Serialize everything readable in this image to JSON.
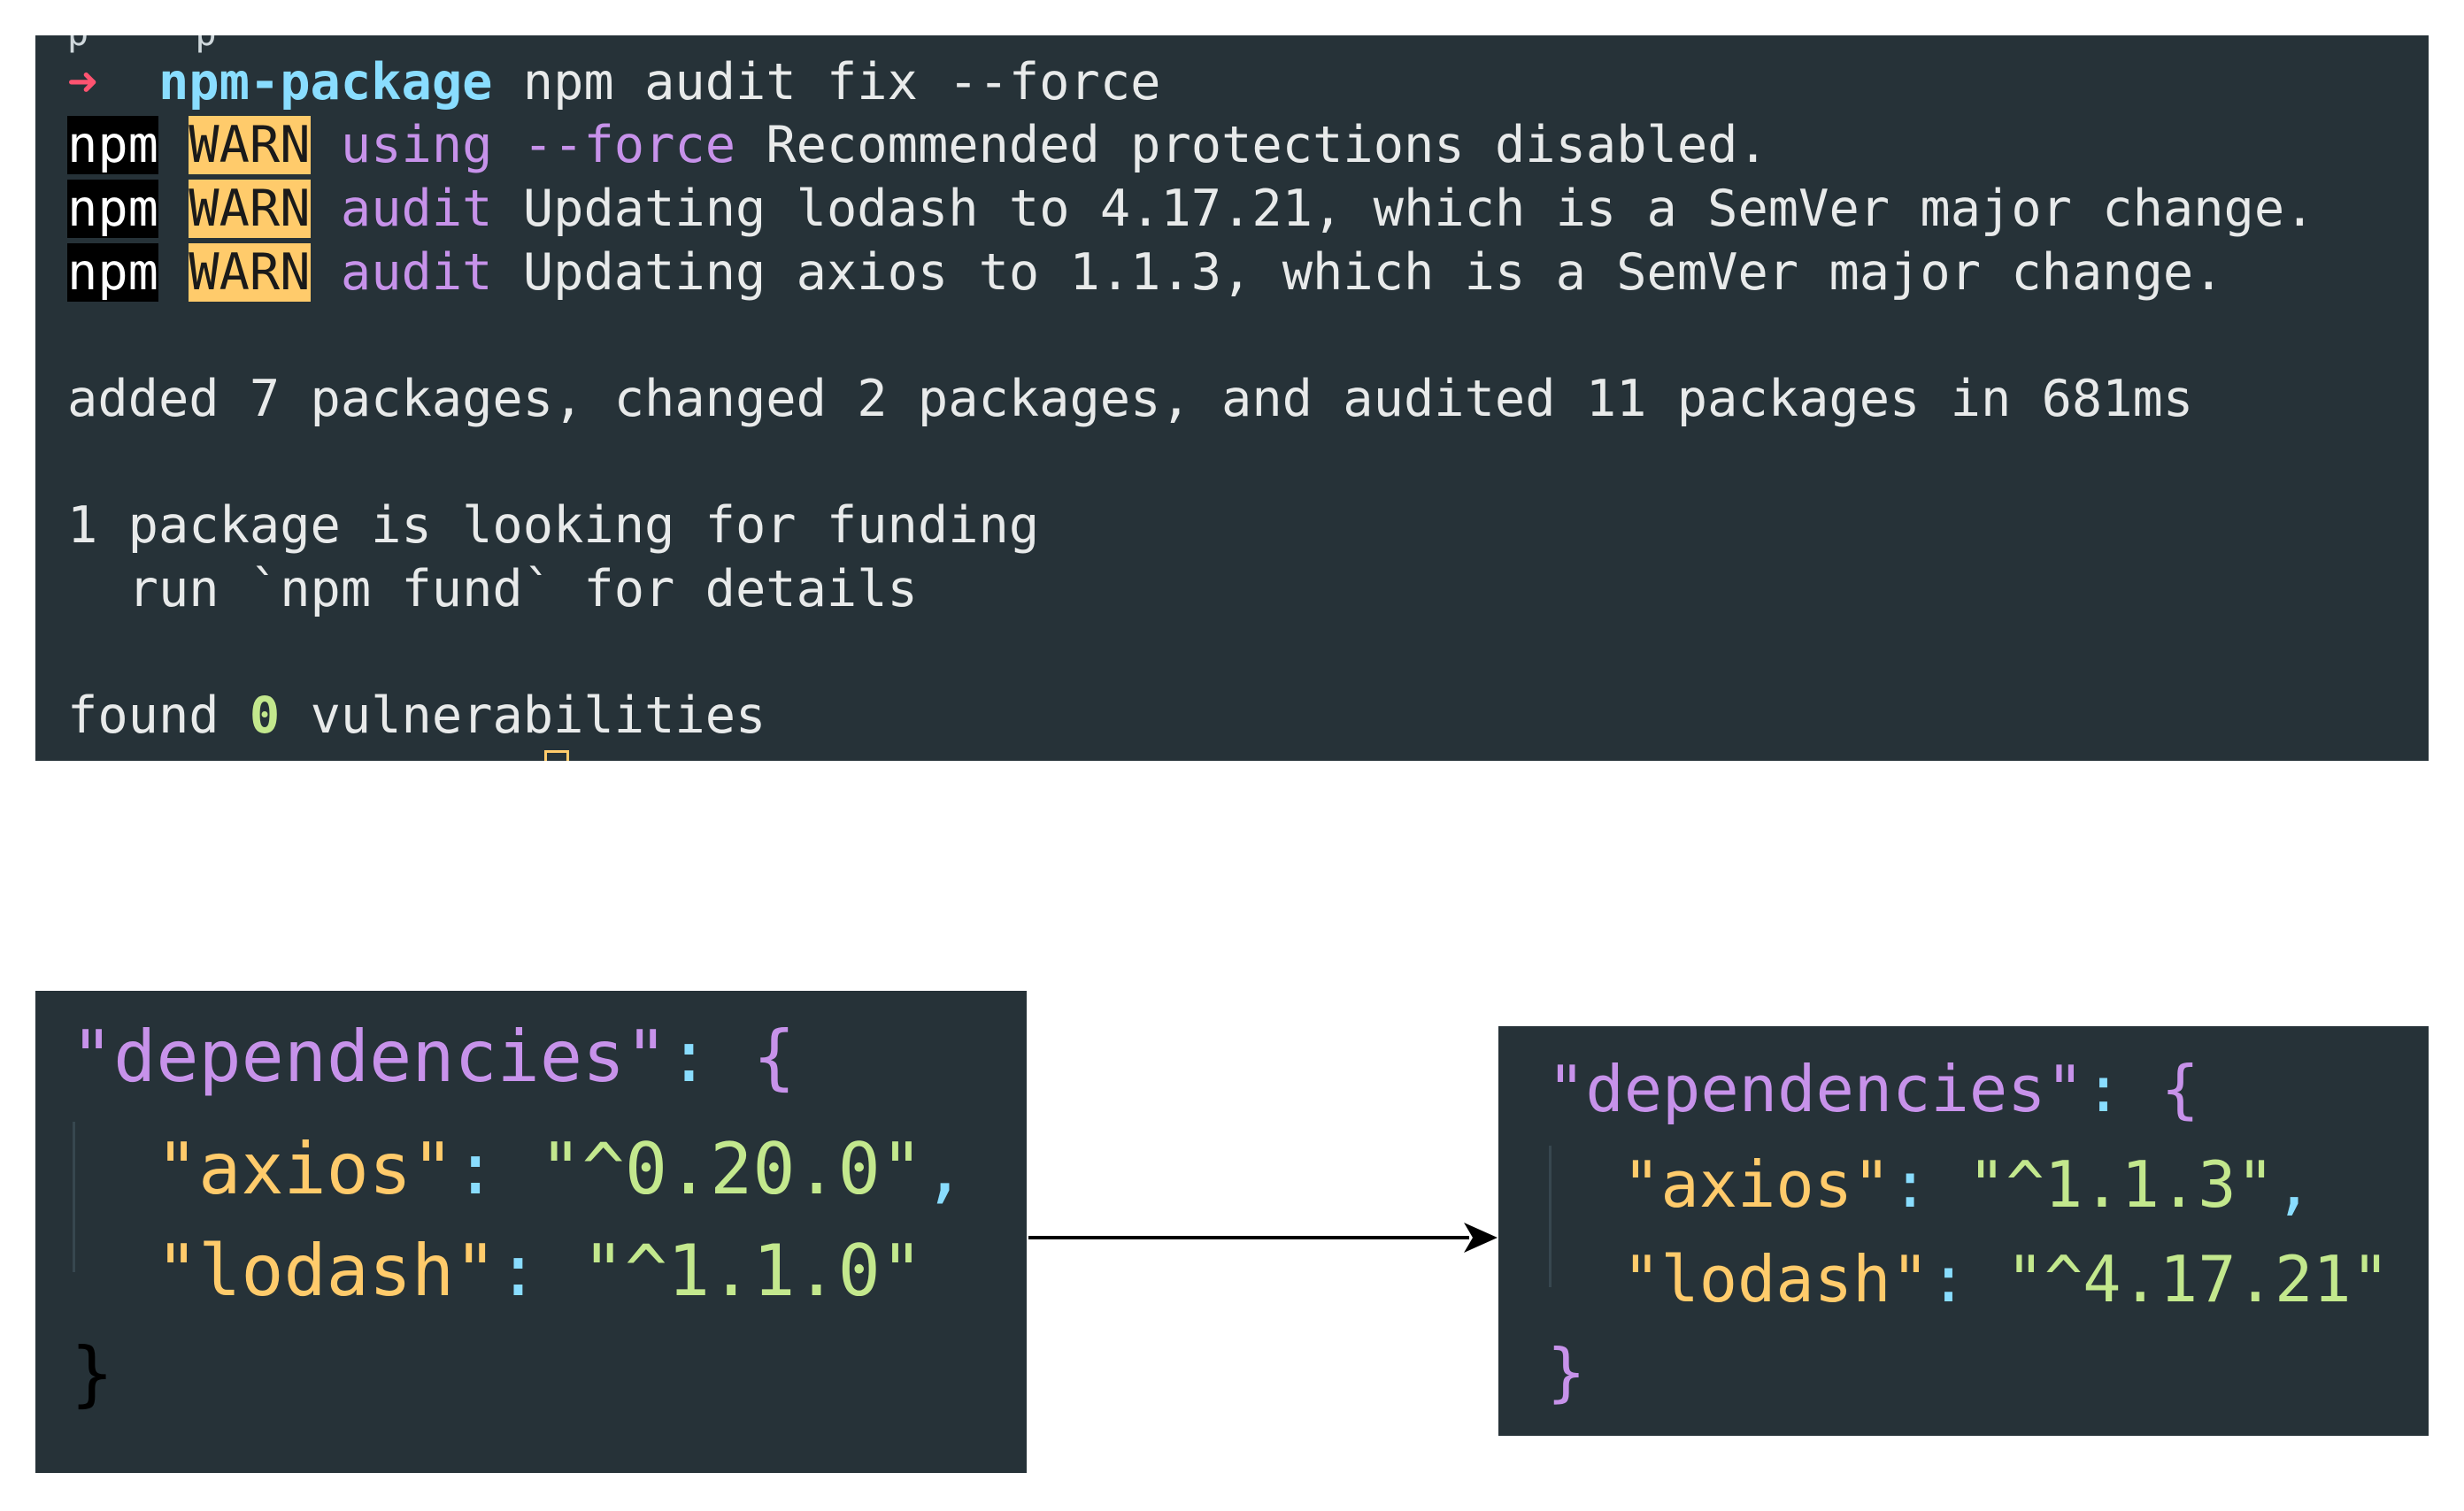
{
  "terminal": {
    "top_fragment": "p  ·  p",
    "prompt_arrow": "➜",
    "directory": "npm-package",
    "command": "npm audit fix --force",
    "warn_lines": [
      {
        "npm": "npm",
        "warn": "WARN",
        "keyword": "using",
        "keyword2": "--force",
        "message": "Recommended protections disabled."
      },
      {
        "npm": "npm",
        "warn": "WARN",
        "keyword": "audit",
        "message": "Updating lodash to 4.17.21, which is a SemVer major change."
      },
      {
        "npm": "npm",
        "warn": "WARN",
        "keyword": "audit",
        "message": "Updating axios to 1.1.3, which is a SemVer major change."
      }
    ],
    "summary": "added 7 packages, changed 2 packages, and audited 11 packages in 681ms",
    "funding_line1": "1 package is looking for funding",
    "funding_line2": "  run `npm fund` for details",
    "found_prefix": "found",
    "found_count": "0",
    "found_suffix": "vulnerabilities"
  },
  "before": {
    "key": "dependencies",
    "open_brace": "{",
    "close_brace": "}",
    "entries": [
      {
        "name": "axios",
        "version": "^0.20.0",
        "comma": ","
      },
      {
        "name": "lodash",
        "version": "^1.1.0",
        "comma": ""
      }
    ]
  },
  "after": {
    "key": "dependencies",
    "open_brace": "{",
    "close_brace": "}",
    "entries": [
      {
        "name": "axios",
        "version": "^1.1.3",
        "comma": ","
      },
      {
        "name": "lodash",
        "version": "^4.17.21",
        "comma": ""
      }
    ]
  },
  "colors": {
    "panel_bg": "#263238",
    "prompt_arrow": "#ff5370",
    "directory": "#89ddff",
    "warn_bg": "#ffcb6b",
    "keyword": "#c792ea",
    "string_key": "#ffcb6b",
    "string_value": "#c3e88d"
  },
  "icons": {
    "arrow": "right-arrow-icon"
  }
}
